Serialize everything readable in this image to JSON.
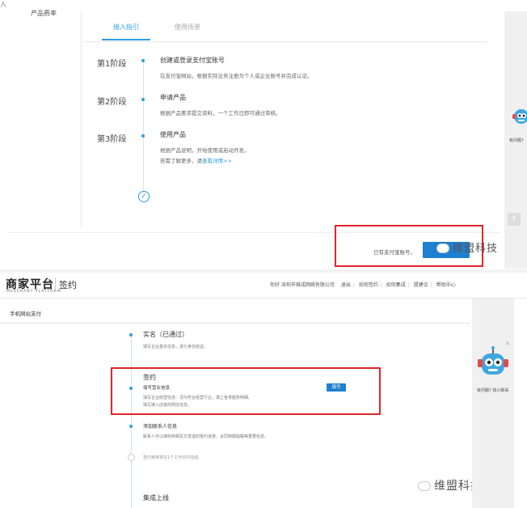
{
  "top": {
    "corner_mark": "入",
    "left_label": "产品费率",
    "tabs": [
      {
        "label": "接入指引",
        "active": true
      },
      {
        "label": "使用场景",
        "active": false
      }
    ],
    "stages": [
      {
        "stage": "第1阶段",
        "title": "创建或登录支付宝账号",
        "desc": "在支付宝网站，根据实际业务注册为个人或企业账号并完成认证。"
      },
      {
        "stage": "第2阶段",
        "title": "申请产品",
        "desc": "根据产品要求提交资料，一个工作日即可通过审核。"
      },
      {
        "stage": "第3阶段",
        "title": "使用产品",
        "desc": "根据产品说明，开始使用或启动开发。",
        "desc2_prefix": "若需了解更多，请",
        "desc2_link": "查看详情>>"
      }
    ],
    "have_account": "已有支付宝账号，",
    "robot_caption": "有问题?",
    "watermark": "维盟科技"
  },
  "bottom": {
    "brand": "商家平台",
    "brand_sub": "MERCHANT PLATFORM",
    "page_title": "签约",
    "header_links": [
      "你好 深圳市维成网络有限公司",
      "退出",
      "如何签约",
      "如何集成",
      "提建议",
      "帮助中心"
    ],
    "sub_bar": "手机网站支付",
    "steps": [
      {
        "title": "实名（已通过）",
        "desc": "填写企业基本信息，进行身份验证。"
      },
      {
        "title": "签约",
        "subtitle": "填写营业信息",
        "desc": "填写企业经营信息：须为符合经营行业，填上各类服务明细。",
        "desc2": "填写接入店家的网址信息。",
        "button": "填写"
      },
      {
        "title": "添加联系人信息",
        "desc": "联系人可以接收到相关方发送的签约进度、合同到期提醒等重要信息。"
      },
      {
        "title": "",
        "desc": "签约审核将在1个工作日内完成。"
      },
      {
        "title": "集成上线",
        "desc": ""
      }
    ],
    "robot_caption": "有问题? 找小助哥",
    "watermark": "维盟科技"
  },
  "colors": {
    "accent": "#2f9cdf",
    "primary_button": "#1f7fd0",
    "highlight_box": "#e0252b"
  }
}
